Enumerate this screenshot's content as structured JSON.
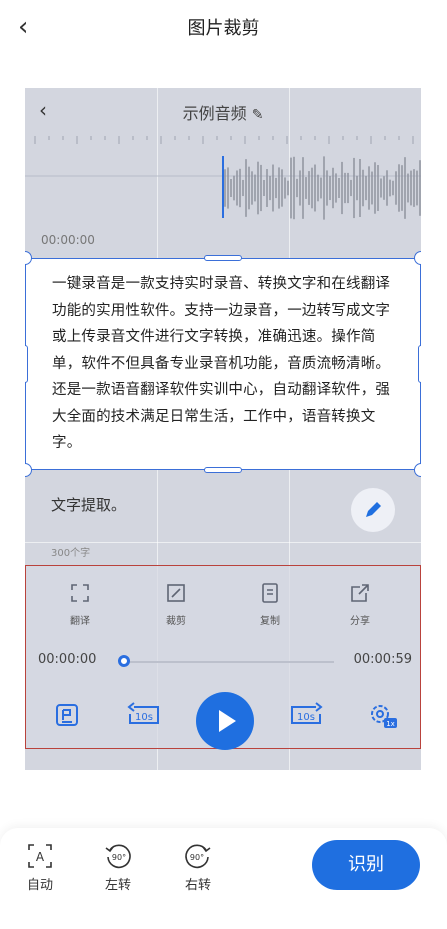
{
  "header": {
    "title": "图片裁剪"
  },
  "preview": {
    "app_title": "示例音频",
    "time_start": "00:00:00",
    "crop_text": "一键录音是一款支持实时录音、转换文字和在线翻译功能的实用性软件。支持一边录音，一边转写成文字或上传录音文件进行文字转换，准确迅速。操作简单，软件不但具备专业录音机功能，音质流畅清晰。还是一款语音翻译软件实训中心，自动翻译软件，强大全面的技术满足日常生活，工作中，语音转换文字。",
    "extract_label": "文字提取。",
    "char_count": "300个字",
    "tools": [
      {
        "label": "翻译",
        "icon": "translate-icon"
      },
      {
        "label": "裁剪",
        "icon": "crop-icon"
      },
      {
        "label": "复制",
        "icon": "copy-icon"
      },
      {
        "label": "分享",
        "icon": "share-icon"
      }
    ],
    "player": {
      "current": "00:00:00",
      "total": "00:00:59",
      "progress": 0.0,
      "skip_back": "10s",
      "skip_forward": "10s",
      "speed": "1x"
    }
  },
  "bottom": {
    "auto_label": "自动",
    "auto_glyph": "A",
    "rotate_left_label": "左转",
    "rotate_right_label": "右转",
    "rotate_glyph": "90°",
    "recognize_label": "识别"
  },
  "colors": {
    "accent": "#1f6fe0",
    "crop_border": "#3b6fd8",
    "panel_border": "#b9423c"
  }
}
